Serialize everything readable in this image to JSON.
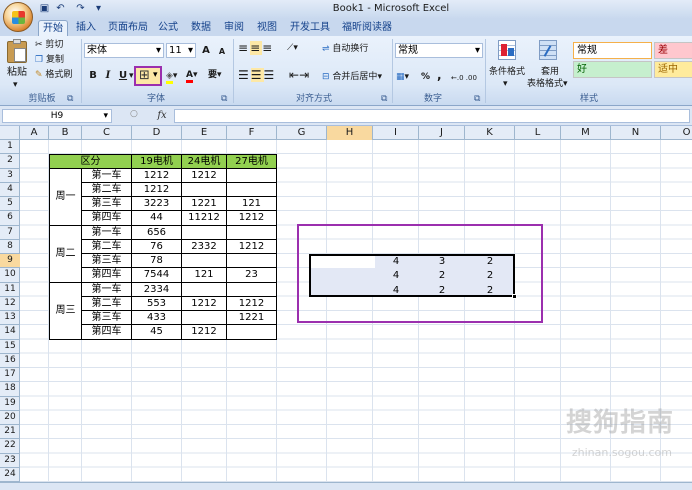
{
  "window": {
    "title": "Book1 - Microsoft Excel"
  },
  "quick_access": {
    "undo_icon": "undo-icon",
    "redo_icon": "redo-icon",
    "save_icon": "save-icon"
  },
  "tabs": [
    "开始",
    "插入",
    "页面布局",
    "公式",
    "数据",
    "审阅",
    "视图",
    "开发工具",
    "福昕阅读器"
  ],
  "active_tab": "开始",
  "clipboard": {
    "paste": "粘贴",
    "cut": "剪切",
    "copy": "复制",
    "format_painter": "格式刷",
    "label": "剪贴板"
  },
  "font": {
    "name": "宋体",
    "size": "11",
    "bold": "B",
    "italic": "I",
    "underline": "U",
    "label": "字体",
    "grow": "A",
    "shrink": "A",
    "phonetic": "要"
  },
  "alignment": {
    "wrap": "自动换行",
    "merge": "合并后居中",
    "label": "对齐方式"
  },
  "number": {
    "format": "常规",
    "percent": "%",
    "comma": ",",
    "inc_decimal": "←.0 .00",
    "dec_decimal": ".00 →.0",
    "label": "数字"
  },
  "styles": {
    "conditional": "条件格式",
    "table_format": "套用\n表格格式",
    "normal": "常规",
    "bad": "差",
    "good": "好",
    "neutral": "适中",
    "label": "样式"
  },
  "formula_bar": {
    "name_box": "H9",
    "fx": "fx",
    "value": ""
  },
  "columns": [
    "A",
    "B",
    "C",
    "D",
    "E",
    "F",
    "G",
    "H",
    "I",
    "J",
    "K",
    "L",
    "M",
    "N",
    "O"
  ],
  "selected_column": "H",
  "rows": [
    "1",
    "2",
    "3",
    "4",
    "5",
    "6",
    "7",
    "8",
    "9",
    "10",
    "11",
    "12",
    "13",
    "14",
    "15",
    "16",
    "17",
    "18",
    "19",
    "20",
    "21",
    "22",
    "23",
    "24"
  ],
  "selected_row": "9",
  "table": {
    "headers": [
      "区分",
      "19电机",
      "24电机",
      "27电机"
    ],
    "groups": [
      {
        "name": "周一",
        "rows": [
          [
            "第一车",
            "1212",
            "1212",
            ""
          ],
          [
            "第二车",
            "1212",
            "",
            ""
          ],
          [
            "第三车",
            "3223",
            "1221",
            "121"
          ],
          [
            "第四车",
            "44",
            "11212",
            "1212"
          ]
        ]
      },
      {
        "name": "周二",
        "rows": [
          [
            "第一车",
            "656",
            "",
            ""
          ],
          [
            "第二车",
            "76",
            "2332",
            "1212"
          ],
          [
            "第三车",
            "78",
            "",
            ""
          ],
          [
            "第四车",
            "7544",
            "121",
            "23"
          ]
        ]
      },
      {
        "name": "周三",
        "rows": [
          [
            "第一车",
            "2334",
            "",
            ""
          ],
          [
            "第二车",
            "553",
            "1212",
            "1212"
          ],
          [
            "第三车",
            "433",
            "",
            "1221"
          ],
          [
            "第四车",
            "45",
            "1212",
            ""
          ]
        ]
      }
    ]
  },
  "selection_values": [
    [
      "4",
      "3",
      "2"
    ],
    [
      "4",
      "2",
      "2"
    ],
    [
      "4",
      "2",
      "2"
    ]
  ],
  "colors": {
    "highlight": "#9b2fae",
    "table_header": "#92d050",
    "selected_header": "#f9d99f"
  },
  "watermark": {
    "text": "搜狗指南",
    "sub": "zhinan.sogou.com"
  }
}
